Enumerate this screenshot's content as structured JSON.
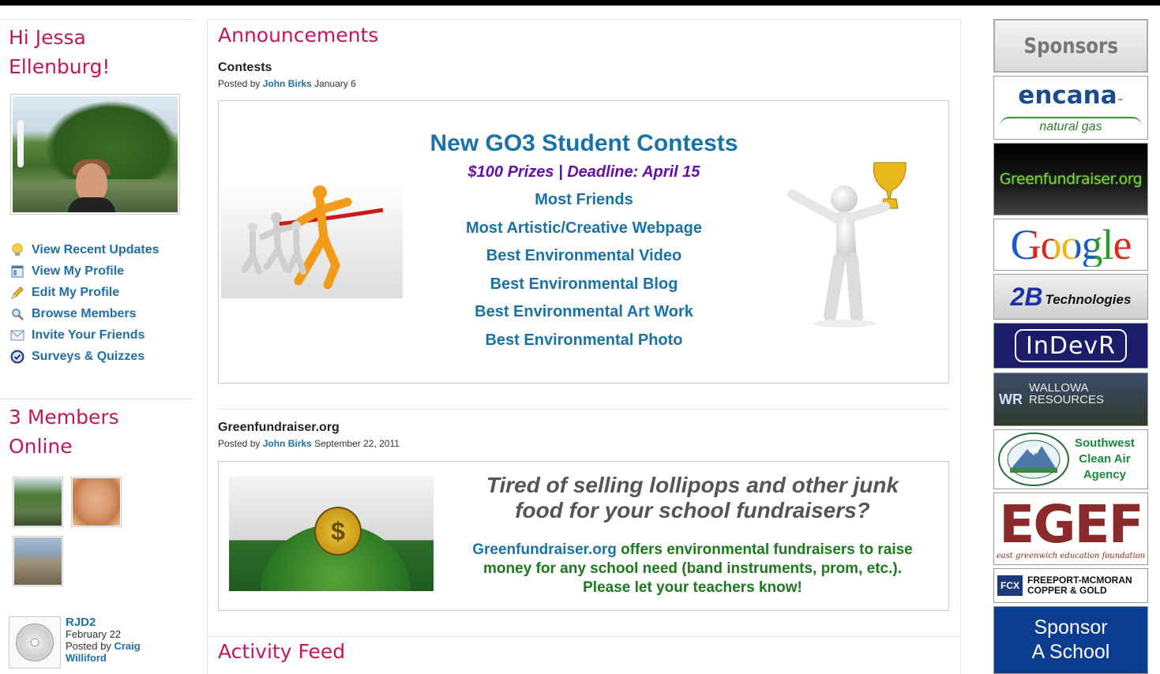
{
  "greeting": {
    "line1": "Hi Jessa",
    "line2": "Ellenburg!"
  },
  "menu": [
    {
      "label": "View Recent Updates",
      "icon": "lightbulb-icon"
    },
    {
      "label": "View My Profile",
      "icon": "profile-window-icon"
    },
    {
      "label": "Edit My Profile",
      "icon": "pencil-icon"
    },
    {
      "label": "Browse Members",
      "icon": "magnifier-icon"
    },
    {
      "label": "Invite Your Friends",
      "icon": "envelope-icon"
    },
    {
      "label": "Surveys & Quizzes",
      "icon": "check-circle-icon"
    }
  ],
  "members_online": {
    "line1": "3 Members",
    "line2": "Online"
  },
  "recent_post": {
    "user": "RJD2",
    "date": "February 22",
    "posted_by": "Posted by",
    "author_first": "Craig",
    "author_last": "Williford"
  },
  "announcements": {
    "title": "Announcements",
    "posts": [
      {
        "title": "Contests",
        "posted_by": "Posted by",
        "author": "John Birks",
        "date": "January 6",
        "headline": "New GO3 Student Contests",
        "prize": "$100 Prizes | Deadline: April 15",
        "categories": [
          "Most Friends",
          "Most Artistic/Creative Webpage",
          "Best Environmental Video",
          "Best Environmental Blog",
          "Best Environmental Art Work",
          "Best Environmental Photo"
        ]
      },
      {
        "title": "Greenfundraiser.org",
        "posted_by": "Posted by",
        "author": "John Birks",
        "date": "September 22, 2011",
        "question_line1": "Tired of selling lollipops and other junk",
        "question_line2": "food for your school fundraisers?",
        "link_text": "Greenfundraiser.org",
        "body_line1_rest": " offers environmental fundraisers to raise",
        "body_line2": "money for any school need (band instruments, prom, etc.).",
        "body_line3": "Please let your teachers know!"
      }
    ]
  },
  "activity_feed": {
    "title": "Activity Feed"
  },
  "sponsors": {
    "title": "Sponsors",
    "encana": {
      "name": "encana",
      "tm": "™",
      "sub": "natural gas"
    },
    "greenfundraiser": "Greenfundraiser.org",
    "google": "Google",
    "twob": {
      "big": "2B",
      "rest": "Technologies"
    },
    "indevr": "InDevR",
    "wallowa": {
      "line1": "WALLOWA",
      "line2": "RESOURCES",
      "mark": "WR"
    },
    "scaa": {
      "line1": "Southwest",
      "line2": "Clean Air",
      "line3": "Agency"
    },
    "egef": {
      "letters": "EGEF",
      "sub": "east greenwich education foundation"
    },
    "freeport": {
      "line1": "FREEPORT-MCMORAN",
      "line2": "COPPER & GOLD",
      "mark": "FCX"
    },
    "sponsor_school": {
      "line1": "Sponsor",
      "line2": "A School"
    }
  },
  "colors": {
    "accent_title": "#c2185b",
    "link_blue": "#1f6fa6",
    "contest_purple": "#6a0dad",
    "fundraiser_green": "#1b7a1b"
  }
}
